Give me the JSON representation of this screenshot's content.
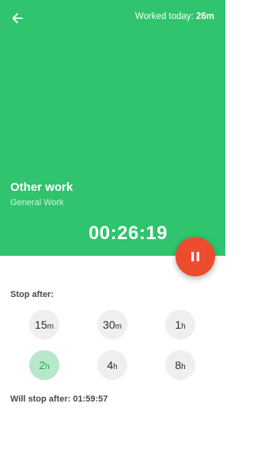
{
  "header": {
    "back_icon": "arrow-left-icon",
    "worked_label": "Worked today: ",
    "worked_value": "26m",
    "background_color": "#2fc46d"
  },
  "task": {
    "title": "Other work",
    "category": "General Work"
  },
  "timer": {
    "elapsed": "00:26:19"
  },
  "pause_button": {
    "icon": "pause-icon",
    "color": "#ee4c2f"
  },
  "stop_after": {
    "label": "Stop after:",
    "options": [
      {
        "num": "15",
        "unit": "m",
        "selected": false
      },
      {
        "num": "30",
        "unit": "m",
        "selected": false
      },
      {
        "num": "1",
        "unit": "h",
        "selected": false
      },
      {
        "num": "2",
        "unit": "h",
        "selected": true
      },
      {
        "num": "4",
        "unit": "h",
        "selected": false
      },
      {
        "num": "8",
        "unit": "h",
        "selected": false
      }
    ],
    "selected_color": "#b8e8c9",
    "summary_label": "Will stop after: ",
    "summary_value": "01:59:57"
  }
}
